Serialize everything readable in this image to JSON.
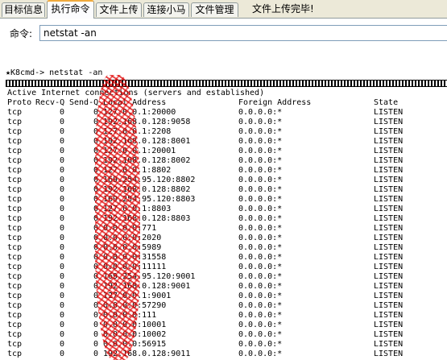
{
  "tabs": [
    {
      "label": "目标信息"
    },
    {
      "label": "执行命令"
    },
    {
      "label": "文件上传"
    },
    {
      "label": "连接小马"
    },
    {
      "label": "文件管理"
    }
  ],
  "status_message": "文件上传完毕!",
  "command": {
    "label": "命令:",
    "value": "netstat -an"
  },
  "console": {
    "prompt": "★K8cmd-> netstat -an",
    "summary": "Active Internet connections (servers and established)",
    "headers": {
      "proto": "Proto",
      "recv": "Recv-Q",
      "send": "Send-Q",
      "local": "Local Address",
      "foreign": "Foreign Address",
      "state": "State"
    },
    "rows": [
      {
        "proto": "tcp",
        "recv": "0",
        "send": "0",
        "local": "127.0.0.1:20000",
        "foreign": "0.0.0.0:*",
        "state": "LISTEN"
      },
      {
        "proto": "tcp",
        "recv": "0",
        "send": "0",
        "local": "192.168.0.128:9058",
        "foreign": "0.0.0.0:*",
        "state": "LISTEN"
      },
      {
        "proto": "tcp",
        "recv": "0",
        "send": "0",
        "local": "127.0.0.1:2208",
        "foreign": "0.0.0.0:*",
        "state": "LISTEN"
      },
      {
        "proto": "tcp",
        "recv": "0",
        "send": "0",
        "local": "192.168.0.128:8001",
        "foreign": "0.0.0.0:*",
        "state": "LISTEN"
      },
      {
        "proto": "tcp",
        "recv": "0",
        "send": "0",
        "local": "127.0.0.1:20001",
        "foreign": "0.0.0.0:*",
        "state": "LISTEN"
      },
      {
        "proto": "tcp",
        "recv": "0",
        "send": "0",
        "local": "192.168.0.128:8002",
        "foreign": "0.0.0.0:*",
        "state": "LISTEN"
      },
      {
        "proto": "tcp",
        "recv": "0",
        "send": "0",
        "local": "127.0.0.1:8802",
        "foreign": "0.0.0.0:*",
        "state": "LISTEN"
      },
      {
        "proto": "tcp",
        "recv": "0",
        "send": "0",
        "local": "169.254.95.120:8802",
        "foreign": "0.0.0.0:*",
        "state": "LISTEN"
      },
      {
        "proto": "tcp",
        "recv": "0",
        "send": "0",
        "local": "192.168.0.128:8802",
        "foreign": "0.0.0.0:*",
        "state": "LISTEN"
      },
      {
        "proto": "tcp",
        "recv": "0",
        "send": "0",
        "local": "169.254.95.120:8803",
        "foreign": "0.0.0.0:*",
        "state": "LISTEN"
      },
      {
        "proto": "tcp",
        "recv": "0",
        "send": "0",
        "local": "127.0.0.1:8803",
        "foreign": "0.0.0.0:*",
        "state": "LISTEN"
      },
      {
        "proto": "tcp",
        "recv": "0",
        "send": "0",
        "local": "192.168.0.128:8803",
        "foreign": "0.0.0.0:*",
        "state": "LISTEN"
      },
      {
        "proto": "tcp",
        "recv": "0",
        "send": "0",
        "local": "0.0.0.0:771",
        "foreign": "0.0.0.0:*",
        "state": "LISTEN"
      },
      {
        "proto": "tcp",
        "recv": "0",
        "send": "0",
        "local": "0.0.0.0:2020",
        "foreign": "0.0.0.0:*",
        "state": "LISTEN"
      },
      {
        "proto": "tcp",
        "recv": "0",
        "send": "0",
        "local": "0.0.0.0:5989",
        "foreign": "0.0.0.0:*",
        "state": "LISTEN"
      },
      {
        "proto": "tcp",
        "recv": "0",
        "send": "0",
        "local": "0.0.0.0:31558",
        "foreign": "0.0.0.0:*",
        "state": "LISTEN"
      },
      {
        "proto": "tcp",
        "recv": "0",
        "send": "0",
        "local": "0.0.0.0:11111",
        "foreign": "0.0.0.0:*",
        "state": "LISTEN"
      },
      {
        "proto": "tcp",
        "recv": "0",
        "send": "0",
        "local": "169.254.95.120:9001",
        "foreign": "0.0.0.0:*",
        "state": "LISTEN"
      },
      {
        "proto": "tcp",
        "recv": "0",
        "send": "0",
        "local": "192.168.0.128:9001",
        "foreign": "0.0.0.0:*",
        "state": "LISTEN"
      },
      {
        "proto": "tcp",
        "recv": "0",
        "send": "0",
        "local": "127.0.0.1:9001",
        "foreign": "0.0.0.0:*",
        "state": "LISTEN"
      },
      {
        "proto": "tcp",
        "recv": "0",
        "send": "0",
        "local": "0.0.0.0:57290",
        "foreign": "0.0.0.0:*",
        "state": "LISTEN"
      },
      {
        "proto": "tcp",
        "recv": "0",
        "send": "0",
        "local": "0.0.0.0:111",
        "foreign": "0.0.0.0:*",
        "state": "LISTEN"
      },
      {
        "proto": "tcp",
        "recv": "0",
        "send": "0",
        "local": "0.0.0.0:10001",
        "foreign": "0.0.0.0:*",
        "state": "LISTEN"
      },
      {
        "proto": "tcp",
        "recv": "0",
        "send": "0",
        "local": "0.0.0.0:10002",
        "foreign": "0.0.0.0:*",
        "state": "LISTEN"
      },
      {
        "proto": "tcp",
        "recv": "0",
        "send": "0",
        "local": "0.0.0.0:56915",
        "foreign": "0.0.0.0:*",
        "state": "LISTEN"
      },
      {
        "proto": "tcp",
        "recv": "0",
        "send": "0",
        "local": "192.168.0.128:9011",
        "foreign": "0.0.0.0:*",
        "state": "LISTEN"
      }
    ]
  }
}
